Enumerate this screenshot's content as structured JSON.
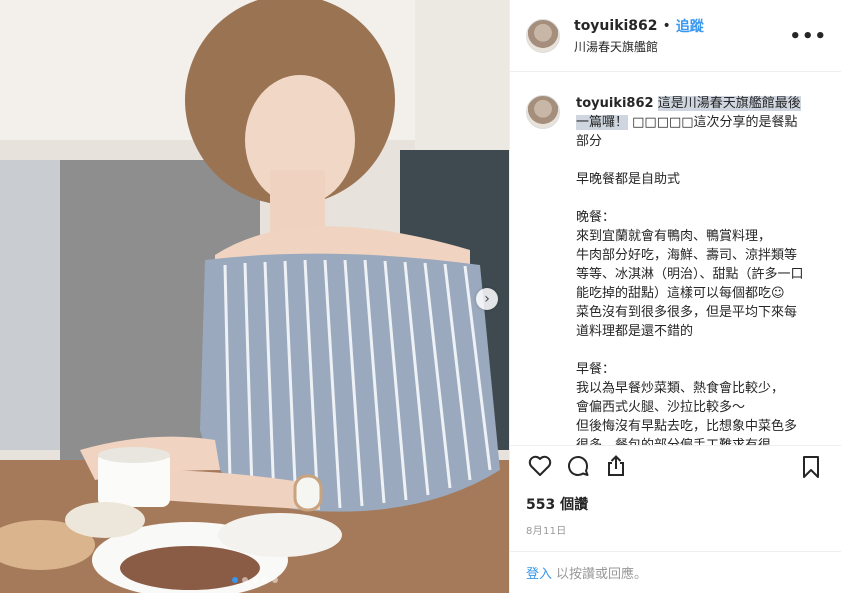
{
  "post": {
    "username": "toyuiki862",
    "separator": "•",
    "follow_label": "追蹤",
    "location": "川湯春天旗艦館",
    "more_label": "•••"
  },
  "caption": {
    "username": "toyuiki862",
    "highlighted": "這是川湯春天旗艦館最後一篇囉！",
    "text": " □□□□□這次分享的是餐點部分\n\n早晚餐都是自助式\n\n晚餐：\n來到宜蘭就會有鴨肉、鴨賞料理，\n牛肉部分好吃，海鮮、壽司、涼拌類等等等、冰淇淋（明治）、甜點（許多一口能吃掉的甜點）這樣可以每個都吃☺\n菜色沒有到很多很多，但是平均下來每道料理都是還不錯的\n\n早餐：\n我以為早餐炒菜類、熱食會比較少，\n會偏西式火腿、沙拉比較多～\n但後悔沒有早點去吃，比想象中菜色多很多，餐包的部分偏手工難求有很"
  },
  "stats": {
    "views": "553 個讚",
    "date": "8月11日"
  },
  "login": {
    "link": "登入",
    "rest": "以按讚或回應。"
  },
  "icons": {
    "like": "heart-icon",
    "comment": "comment-icon",
    "share": "share-icon",
    "save": "bookmark-icon",
    "next": "chevron-right-icon"
  },
  "carousel": {
    "count": 5,
    "active": 1
  },
  "colors": {
    "accent": "#3897f0",
    "border": "#efefef",
    "text": "#262626",
    "muted": "#999999"
  }
}
